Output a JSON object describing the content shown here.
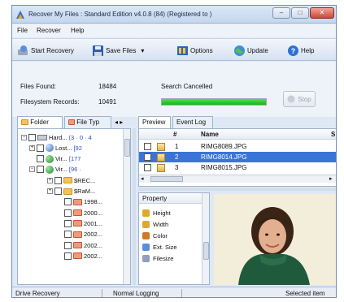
{
  "window": {
    "title": "Recover My Files : Standard Edition v4.0.8 (84)  (Registered to )",
    "btn_min": "–",
    "btn_max": "□",
    "btn_close": "✕"
  },
  "menu": [
    "File",
    "Recover",
    "Help"
  ],
  "toolbar": {
    "start_recovery": "Start Recovery",
    "save_files": "Save Files",
    "save_dropdown": "▾",
    "options": "Options",
    "update": "Update",
    "help": "Help"
  },
  "status": {
    "files_found_label": "Files Found:",
    "files_found_value": "18484",
    "fs_records_label": "Filesystem Records:",
    "fs_records_value": "10491",
    "search_state": "Search Cancelled",
    "progress_percent": 100,
    "stop_label": "Stop"
  },
  "left_tabs": {
    "folder": "Folder",
    "file_type": "File Typ",
    "arrows": "◂ ▸"
  },
  "tree": [
    {
      "label": "Hard...",
      "count": "(3 · 0 · 4",
      "expander": "⊟",
      "icon": "drive"
    },
    {
      "label": "Lost...",
      "count": "[92",
      "expander": "⊞",
      "icon": "lost"
    },
    {
      "label": "Vir...",
      "count": "[177",
      "expander": "",
      "icon": "volume"
    },
    {
      "label": "Vir...",
      "count": "[96 ·",
      "expander": "⊟",
      "icon": "volume"
    },
    {
      "label": "$REC...",
      "count": "",
      "expander": "⊞",
      "icon": "folder"
    },
    {
      "label": "$RaM...",
      "count": "",
      "expander": "⊞",
      "icon": "folder"
    },
    {
      "label": "1998...",
      "count": "",
      "expander": "",
      "icon": "folder-red"
    },
    {
      "label": "2000...",
      "count": "",
      "expander": "",
      "icon": "folder-red"
    },
    {
      "label": "2001...",
      "count": "",
      "expander": "",
      "icon": "folder-red"
    },
    {
      "label": "2002...",
      "count": "",
      "expander": "",
      "icon": "folder-red"
    },
    {
      "label": "2002...",
      "count": "",
      "expander": "",
      "icon": "folder-red"
    },
    {
      "label": "2002...",
      "count": "",
      "expander": "",
      "icon": "folder-red"
    }
  ],
  "right_tabs": {
    "preview": "Preview",
    "event_log": "Event Log"
  },
  "grid": {
    "col_num": "#",
    "col_name": "Name",
    "col_s": "S",
    "rows": [
      {
        "num": "1",
        "name": "RIMG8089.JPG",
        "selected": false
      },
      {
        "num": "2",
        "name": "RIMG8014.JPG",
        "selected": true
      },
      {
        "num": "3",
        "name": "RIMG8015.JPG",
        "selected": false
      }
    ]
  },
  "properties": {
    "header": "Property",
    "items": [
      "Height",
      "Width",
      "Color",
      "Ext. Size",
      "Filesize"
    ]
  },
  "statusbar": {
    "left": "Drive Recovery",
    "middle": "Normal Logging",
    "right": "Selected item"
  }
}
